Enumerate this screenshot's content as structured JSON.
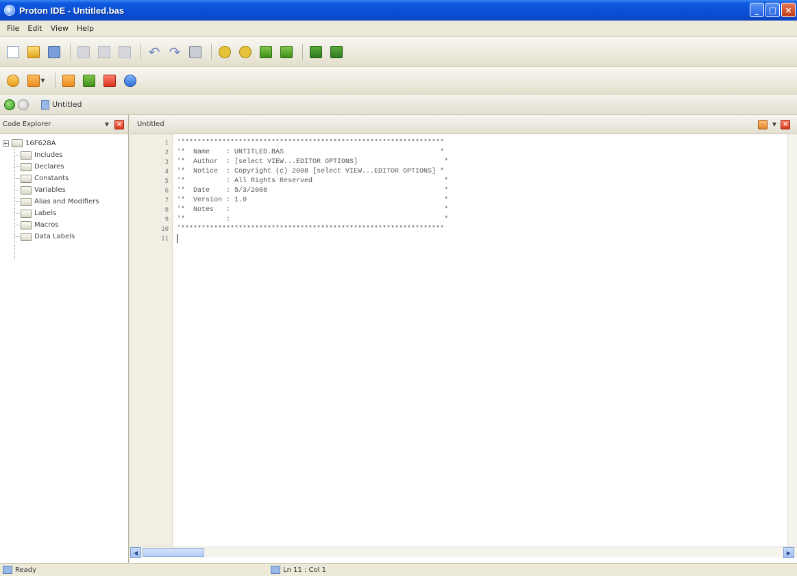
{
  "window": {
    "title": "Proton IDE - Untitled.bas",
    "controls": [
      "_",
      "□",
      "×"
    ]
  },
  "menu": {
    "items": [
      "File",
      "Edit",
      "View",
      "Help"
    ]
  },
  "docbar": {
    "tab_label": "Untitled"
  },
  "explorer": {
    "title": "Code Explorer",
    "root_label": "16F628A",
    "expander": "+",
    "items": [
      "Includes",
      "Declares",
      "Constants",
      "Variables",
      "Alias and Modifiers",
      "Labels",
      "Macros",
      "Data Labels"
    ]
  },
  "editor": {
    "tab_title": "Untitled",
    "lines": [
      {
        "num": "1",
        "text": "'****************************************************************"
      },
      {
        "num": "2",
        "text": "'*  Name    : UNTITLED.BAS                                      *"
      },
      {
        "num": "3",
        "text": "'*  Author  : [select VIEW...EDITOR OPTIONS]                     *"
      },
      {
        "num": "4",
        "text": "'*  Notice  : Copyright (c) 2008 [select VIEW...EDITOR OPTIONS] *"
      },
      {
        "num": "5",
        "text": "'*          : All Rights Reserved                                *"
      },
      {
        "num": "6",
        "text": "'*  Date    : 5/3/2008                                           *"
      },
      {
        "num": "7",
        "text": "'*  Version : 1.0                                                *"
      },
      {
        "num": "8",
        "text": "'*  Notes   :                                                    *"
      },
      {
        "num": "9",
        "text": "'*          :                                                    *"
      },
      {
        "num": "10",
        "text": "'****************************************************************"
      },
      {
        "num": "11",
        "text": ""
      }
    ]
  },
  "status": {
    "state": "Ready",
    "position": "Ln 11 : Col 1"
  },
  "icons": {
    "toolbar1": [
      "new-file-icon",
      "open-file-icon",
      "save-icon",
      "cut-icon",
      "copy-icon",
      "paste-icon",
      "undo-icon",
      "redo-icon",
      "print-icon",
      "compile-icon",
      "compile-program-icon",
      "program-icon",
      "program-verify-icon",
      "assemble-icon",
      "assemble-program-icon"
    ],
    "toolbar2": [
      "bookmark-icon",
      "goto-icon",
      "plugin-icon",
      "add-plugin-icon",
      "remove-plugin-icon",
      "find-plugin-icon"
    ]
  }
}
